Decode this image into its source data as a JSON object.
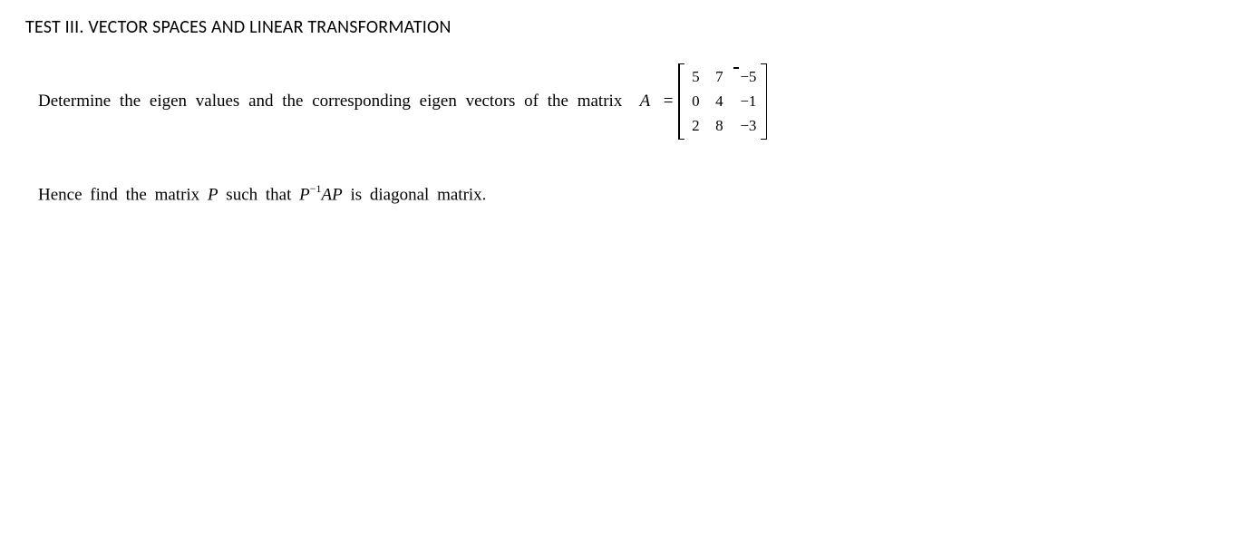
{
  "title": "TEST III. VECTOR SPACES AND LINEAR TRANSFORMATION",
  "line1": {
    "prefix": "Determine the eigen values and the corresponding eigen vectors of the matrix",
    "matrix_var": "A",
    "equals": "="
  },
  "matrix": {
    "rows": [
      [
        "5",
        "7",
        "−5"
      ],
      [
        "0",
        "4",
        "−1"
      ],
      [
        "2",
        "8",
        "−3"
      ]
    ]
  },
  "line2": {
    "t1": "Hence find the matrix ",
    "P": "P",
    "t2": " such that ",
    "P2": "P",
    "exp": "−1",
    "A": "A",
    "P3": "P",
    "t3": " is diagonal matrix."
  }
}
